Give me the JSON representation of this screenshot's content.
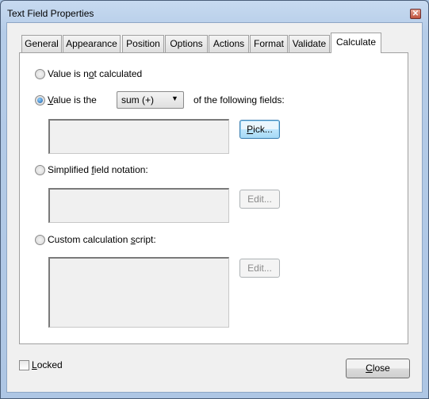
{
  "window": {
    "title": "Text Field Properties"
  },
  "tabs": [
    {
      "label": "General"
    },
    {
      "label": "Appearance"
    },
    {
      "label": "Position"
    },
    {
      "label": "Options"
    },
    {
      "label": "Actions"
    },
    {
      "label": "Format"
    },
    {
      "label": "Validate"
    },
    {
      "label": "Calculate",
      "active": true
    }
  ],
  "calculate": {
    "not_calculated": {
      "pre": "Value is n",
      "u": "o",
      "post": "t calculated",
      "checked": false
    },
    "value_is": {
      "u": "V",
      "post": "alue is the",
      "checked": true
    },
    "operation": {
      "selected": "sum (+)"
    },
    "following_fields": "of the following fields:",
    "fields_value": "",
    "pick_button": {
      "u": "P",
      "post": "ick..."
    },
    "simplified": {
      "pre": "Simplified ",
      "u": "f",
      "post": "ield notation:",
      "checked": false
    },
    "simplified_value": "",
    "edit_label": "Edit...",
    "custom": {
      "pre": "Custom calculation ",
      "u": "s",
      "post": "cript:",
      "checked": false
    },
    "custom_value": ""
  },
  "footer": {
    "locked": {
      "label_u": "L",
      "label_post": "ocked",
      "checked": false
    },
    "close_button": {
      "u": "C",
      "post": "lose"
    }
  }
}
